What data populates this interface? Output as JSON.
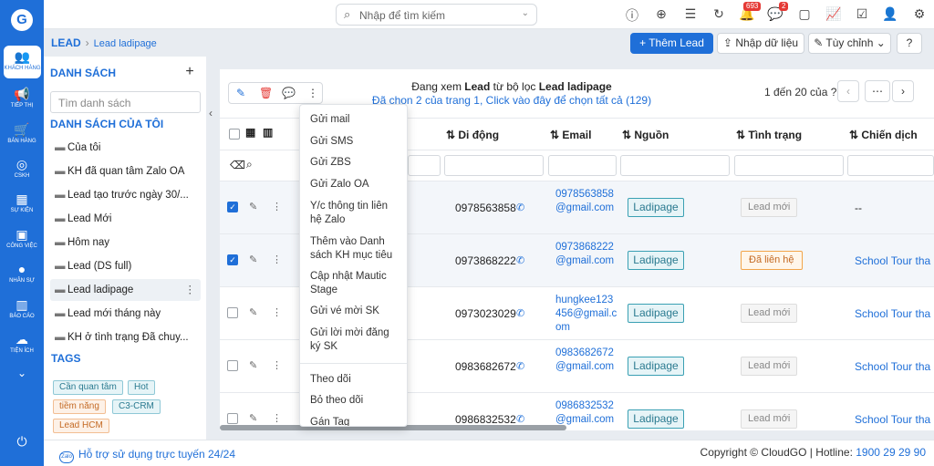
{
  "nav": {
    "items": [
      {
        "label": "KHÁCH HÀNG",
        "icon": "users-icon"
      },
      {
        "label": "TIẾP THỊ",
        "icon": "megaphone-icon"
      },
      {
        "label": "BÁN HÀNG",
        "icon": "cart-icon"
      },
      {
        "label": "CSKH",
        "icon": "support-icon"
      },
      {
        "label": "SỰ KIỆN",
        "icon": "calendar-icon"
      },
      {
        "label": "CÔNG VIỆC",
        "icon": "briefcase-icon"
      },
      {
        "label": "NHÂN SỰ",
        "icon": "person-icon"
      },
      {
        "label": "BÁO CÁO",
        "icon": "report-icon"
      },
      {
        "label": "TIỆN ÍCH",
        "icon": "utility-icon"
      }
    ]
  },
  "topbar": {
    "search_placeholder": "Nhập để tìm kiếm",
    "badge_notifications": "693",
    "badge_messages": "2"
  },
  "breadcrumb": {
    "root": "LEAD",
    "current": "Lead ladipage"
  },
  "toolbar": {
    "add_label": "Thêm Lead",
    "import_label": "Nhập dữ liệu",
    "custom_label": "Tùy chỉnh"
  },
  "sidebar": {
    "header": "DANH SÁCH",
    "search_placeholder": "Tìm danh sách",
    "my_lists_header": "DANH SÁCH CỦA TÔI",
    "items": [
      "Của tôi",
      "KH đã quan tâm Zalo OA",
      "Lead tạo trước ngày 30/...",
      "Lead Mới",
      "Hôm nay",
      "Lead (DS full)",
      "Lead ladipage",
      "Lead mới tháng này",
      "KH ở tình trạng Đã chuy..."
    ],
    "tags_header": "TAGS",
    "tags": [
      "Cần quan tâm",
      "Hot",
      "tiềm năng",
      "C3-CRM",
      "Lead HCM"
    ]
  },
  "info": {
    "prefix": "Đang xem ",
    "entity": "Lead",
    "middle": " từ bộ lọc ",
    "filter": "Lead ladipage",
    "selection": "Đã chọn 2 của trang 1, Click vào đây để chọn tất cả (129)"
  },
  "pagination": {
    "text": "1 đến 20 của ?"
  },
  "table": {
    "headers": {
      "phone": "Di động",
      "email": "Email",
      "source": "Nguồn",
      "status": "Tình trạng",
      "campaign": "Chiến dịch"
    },
    "rows": [
      {
        "checked": true,
        "phone": "0978563858",
        "email": "0978563858@gmail.com",
        "source": "Ladipage",
        "status": "Lead mới",
        "campaign": "--"
      },
      {
        "checked": true,
        "phone": "0973868222",
        "email": "0973868222@gmail.com",
        "source": "Ladipage",
        "status": "Đã liên hệ",
        "campaign": "School Tour tha"
      },
      {
        "checked": false,
        "phone": "0973023029",
        "email": "hungkee123456@gmail.com",
        "source": "Ladipage",
        "status": "Lead mới",
        "campaign": "School Tour tha"
      },
      {
        "checked": false,
        "phone": "0983682672",
        "email": "0983682672@gmail.com",
        "source": "Ladipage",
        "status": "Lead mới",
        "campaign": "School Tour tha"
      },
      {
        "checked": false,
        "phone": "0986832532",
        "email": "0986832532@gmail.com",
        "source": "Ladipage",
        "status": "Lead mới",
        "campaign": "School Tour tha"
      }
    ]
  },
  "dropdown": {
    "items": [
      "Gửi mail",
      "Gửi SMS",
      "Gửi ZBS",
      "Gửi Zalo OA",
      "Y/c thông tin liên hệ Zalo",
      "Thêm vào Danh sách KH mục tiêu",
      "Cập nhật Mautic Stage",
      "Gửi vé mời SK",
      "Gửi lời mời đăng ký SK",
      "Theo dõi",
      "Bỏ theo dõi",
      "Gán Tag"
    ]
  },
  "footer": {
    "support": "Hỗ trợ sử dụng trực tuyến 24/24",
    "zalo": "Zalo",
    "copyright": "Copyright © CloudGO | Hotline: ",
    "hotline": "1900 29 29 90"
  },
  "colors": {
    "primary": "#1f6fd8",
    "source_tag": "#3aa0b3",
    "warning": "#f2a54a"
  }
}
